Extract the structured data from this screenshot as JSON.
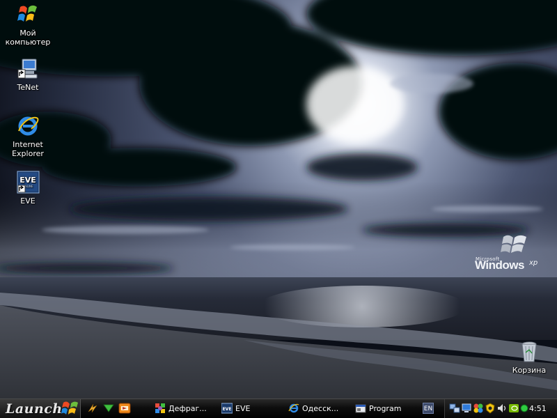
{
  "desktop": {
    "icons": [
      {
        "label": "Мой\nкомпьютер",
        "icon": "windows-flag-icon"
      },
      {
        "label": "TeNet",
        "icon": "network-computer-icon"
      },
      {
        "label": "Internet\nExplorer",
        "icon": "internet-explorer-icon"
      },
      {
        "label": "EVE",
        "icon": "eve-online-icon"
      },
      {
        "label": "Корзина",
        "icon": "recycle-bin-icon"
      }
    ],
    "logo": {
      "microsoft": "Microsoft",
      "windows": "Windows",
      "xp": "xp"
    }
  },
  "taskbar": {
    "start_label": "Launch",
    "quick_launch": [
      "lightning-icon",
      "download-arrow-icon",
      "media-icon"
    ],
    "tasks": [
      {
        "label": "Дефраг...",
        "icon": "defrag-icon"
      },
      {
        "label": "EVE",
        "icon": "eve-online-icon"
      },
      {
        "label": "Одесск...",
        "icon": "internet-explorer-icon"
      },
      {
        "label": "Program",
        "icon": "program-window-icon"
      }
    ],
    "language": "EN",
    "tray_icons": [
      "network-icon",
      "monitor-icon",
      "color-wheel-icon",
      "antivirus-icon",
      "volume-icon",
      "nvidia-icon",
      "green-status-icon"
    ],
    "clock": "4:51"
  }
}
